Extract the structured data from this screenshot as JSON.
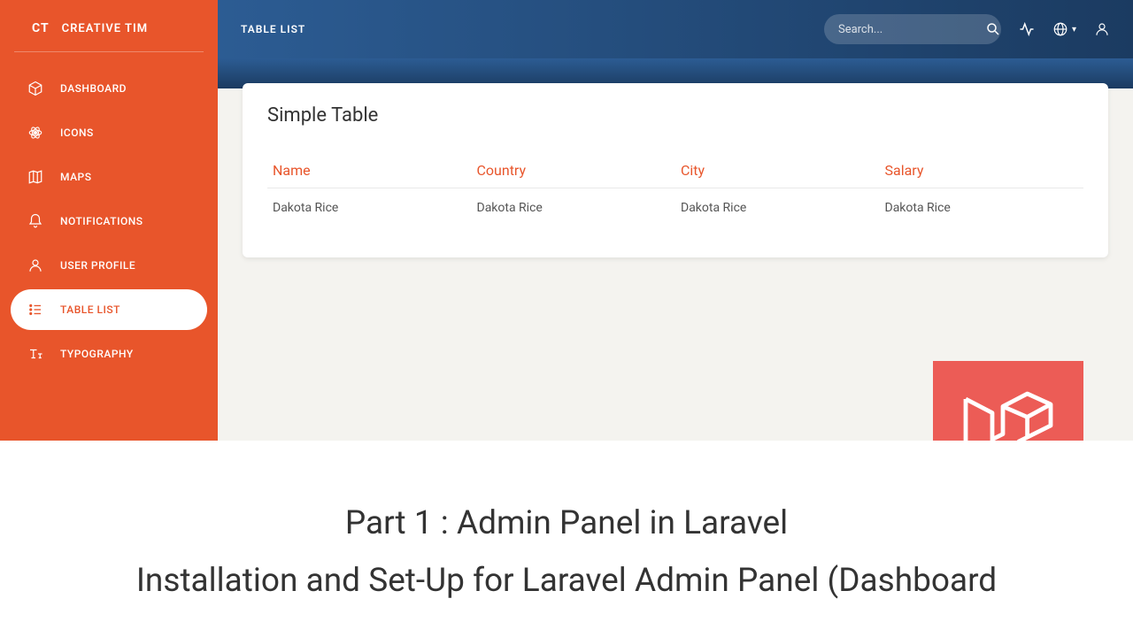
{
  "brand": {
    "logo": "CT",
    "name": "CREATIVE TIM"
  },
  "sidebar": {
    "items": [
      {
        "label": "DASHBOARD",
        "icon": "cube"
      },
      {
        "label": "ICONS",
        "icon": "atom"
      },
      {
        "label": "MAPS",
        "icon": "map"
      },
      {
        "label": "NOTIFICATIONS",
        "icon": "bell"
      },
      {
        "label": "USER PROFILE",
        "icon": "user"
      },
      {
        "label": "TABLE LIST",
        "icon": "list"
      },
      {
        "label": "TYPOGRAPHY",
        "icon": "text"
      }
    ],
    "activeIndex": 5
  },
  "topbar": {
    "title": "TABLE LIST",
    "searchPlaceholder": "Search..."
  },
  "card": {
    "title": "Simple Table",
    "columns": [
      "Name",
      "Country",
      "City",
      "Salary"
    ],
    "rows": [
      [
        "Dakota Rice",
        "Dakota Rice",
        "Dakota Rice",
        "Dakota Rice"
      ]
    ]
  },
  "overlay": {
    "line1": "Part 1 : Admin Panel in Laravel",
    "line2": "Installation and Set-Up for Laravel Admin Panel (Dashboard"
  }
}
